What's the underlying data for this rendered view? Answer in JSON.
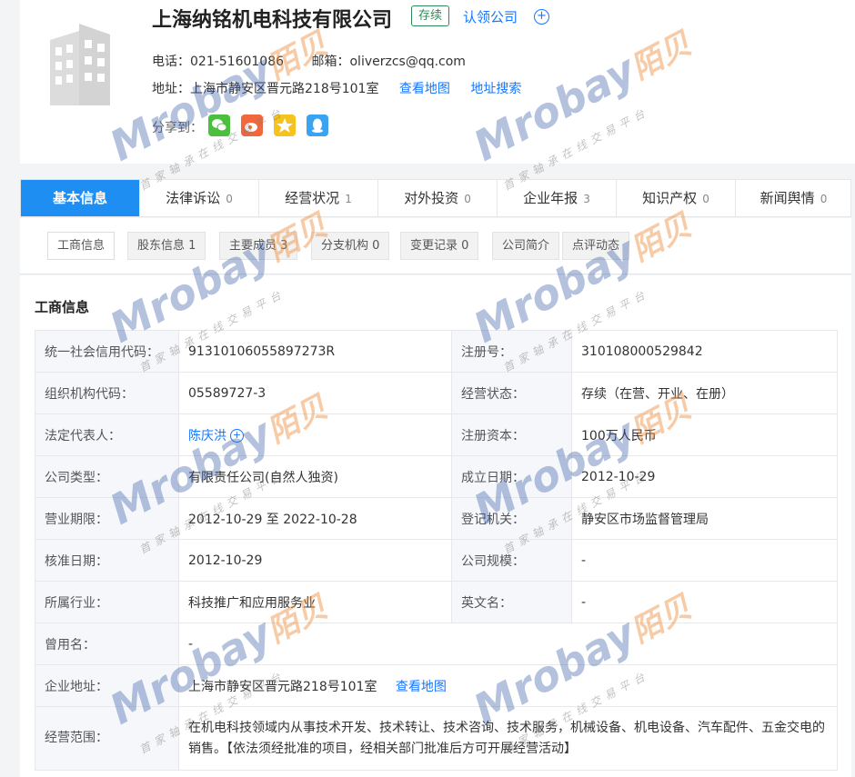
{
  "company": {
    "name": "上海纳铭机电科技有限公司",
    "status": "存续",
    "claim_label": "认领公司",
    "phone_text": "电话：021-51601086",
    "email_text": "邮箱：oliverzcs@qq.com",
    "address_text": "地址：上海市静安区晋元路218号101室",
    "map_link": "查看地图",
    "address_search_link": "地址搜索",
    "share_label": "分享到："
  },
  "tabs": [
    {
      "label": "基本信息",
      "count": ""
    },
    {
      "label": "法律诉讼",
      "count": "0"
    },
    {
      "label": "经营状况",
      "count": "1"
    },
    {
      "label": "对外投资",
      "count": "0"
    },
    {
      "label": "企业年报",
      "count": "3"
    },
    {
      "label": "知识产权",
      "count": "0"
    },
    {
      "label": "新闻舆情",
      "count": "0"
    }
  ],
  "subtabs": [
    "工商信息",
    "股东信息 1",
    "主要成员 3",
    "分支机构 0",
    "变更记录 0",
    "公司简介",
    "点评动态"
  ],
  "section_title": "工商信息",
  "info": {
    "credit_code_label": "统一社会信用代码：",
    "credit_code": "91310106055897273R",
    "reg_no_label": "注册号：",
    "reg_no": "310108000529842",
    "org_code_label": "组织机构代码：",
    "org_code": "05589727-3",
    "biz_status_label": "经营状态：",
    "biz_status": "存续（在营、开业、在册）",
    "legal_rep_label": "法定代表人：",
    "legal_rep": "陈庆洪",
    "reg_capital_label": "注册资本：",
    "reg_capital": "100万人民币",
    "company_type_label": "公司类型：",
    "company_type": "有限责任公司(自然人独资)",
    "established_label": "成立日期：",
    "established": "2012-10-29",
    "term_label": "营业期限：",
    "term": "2012-10-29 至 2022-10-28",
    "authority_label": "登记机关：",
    "authority": "静安区市场监督管理局",
    "approved_label": "核准日期：",
    "approved": "2012-10-29",
    "scale_label": "公司规模：",
    "scale": "-",
    "industry_label": "所属行业：",
    "industry": "科技推广和应用服务业",
    "en_name_label": "英文名：",
    "en_name": "-",
    "former_name_label": "曾用名：",
    "former_name": "-",
    "address_label": "企业地址：",
    "address": "上海市静安区晋元路218号101室",
    "address_map_link": "查看地图",
    "scope_label": "经营范围：",
    "scope": "在机电科技领域内从事技术开发、技术转让、技术咨询、技术服务，机械设备、机电设备、汽车配件、五金交电的销售。【依法须经批准的项目，经相关部门批准后方可开展经营活动】"
  },
  "watermark": {
    "brand": "Mrobay",
    "brand_cn": "陌贝",
    "slogan": "首家轴承在线交易平台"
  },
  "colors": {
    "accent": "#1e8ef2",
    "link": "#1677ff",
    "status": "#2e8b57"
  }
}
